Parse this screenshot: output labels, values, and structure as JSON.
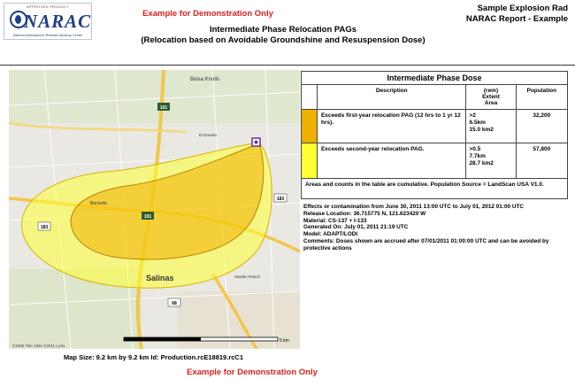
{
  "logo": {
    "approved": "APPROVED PRODUCT",
    "name": "NARAC",
    "tagline": "National Atmospheric Release Advisory Center"
  },
  "header": {
    "demo_top": "Example  for Demonstration  Only",
    "title_line1": "Intermediate  Phase Relocation  PAGs",
    "title_line2": "(Relocation  based  on Avoidable  Groundshine  and Resuspension  Dose)",
    "report_line1": "Sample  Explosion  Rad",
    "report_line2": "NARAC Report - Example"
  },
  "map": {
    "labels": [
      "Boisa Knolls",
      "Salinas",
      "Boronda",
      "El Dorado",
      "Harden Ranch"
    ],
    "route_shields": [
      "101",
      "101",
      "183",
      "68",
      "183"
    ],
    "credit": "©2005 Tele Atlas  ©2011 LLNL",
    "scale_end": "5 km"
  },
  "map_caption": "Map  Size:  9.2  km  by  9.2  km     Id:  Production.rcE18819.rcC1",
  "table": {
    "title": "Intermediate  Phase  Dose",
    "headers": {
      "description": "Description",
      "extent": "(rem)\nExtent\nArea",
      "population": "Population"
    },
    "rows": [
      {
        "color": "#f0b000",
        "description": "Exceeds  first-year  relocation  PAG  (12 hrs to  1 yr 12 hrs).",
        "extent": ">2\n6.5km\n15.0  km2",
        "population": "32,200"
      },
      {
        "color": "#ffff33",
        "description": "Exceeds  second-year  relocation  PAG.",
        "extent": ">0.5\n7.7km\n28.7  km2",
        "population": "57,800"
      }
    ],
    "note": "Areas  and  counts  in  the  table  are  cumulative.  Population  Source = LandScan  USA  V1.0."
  },
  "details": {
    "effects": "Effects or contamination from June 30, 2011  13:00  UTC to July 01, 2012  01:00  UTC",
    "location": "Release  Location: 36.715775  N,  121.623420  W",
    "material": "Material:  CS-137  + I-133",
    "generated": "Generated  On: July  01, 2011  21:19  UTC",
    "model": "Model:  ADAPT/LODI",
    "comments": "Comments:  Doses  shown  are  accrued  after  07/01/2011   01:00:00  UTC and  can  be avoided  by  protective  actions"
  },
  "footer": {
    "demo_bottom": "Example  for Demonstration  Only"
  }
}
